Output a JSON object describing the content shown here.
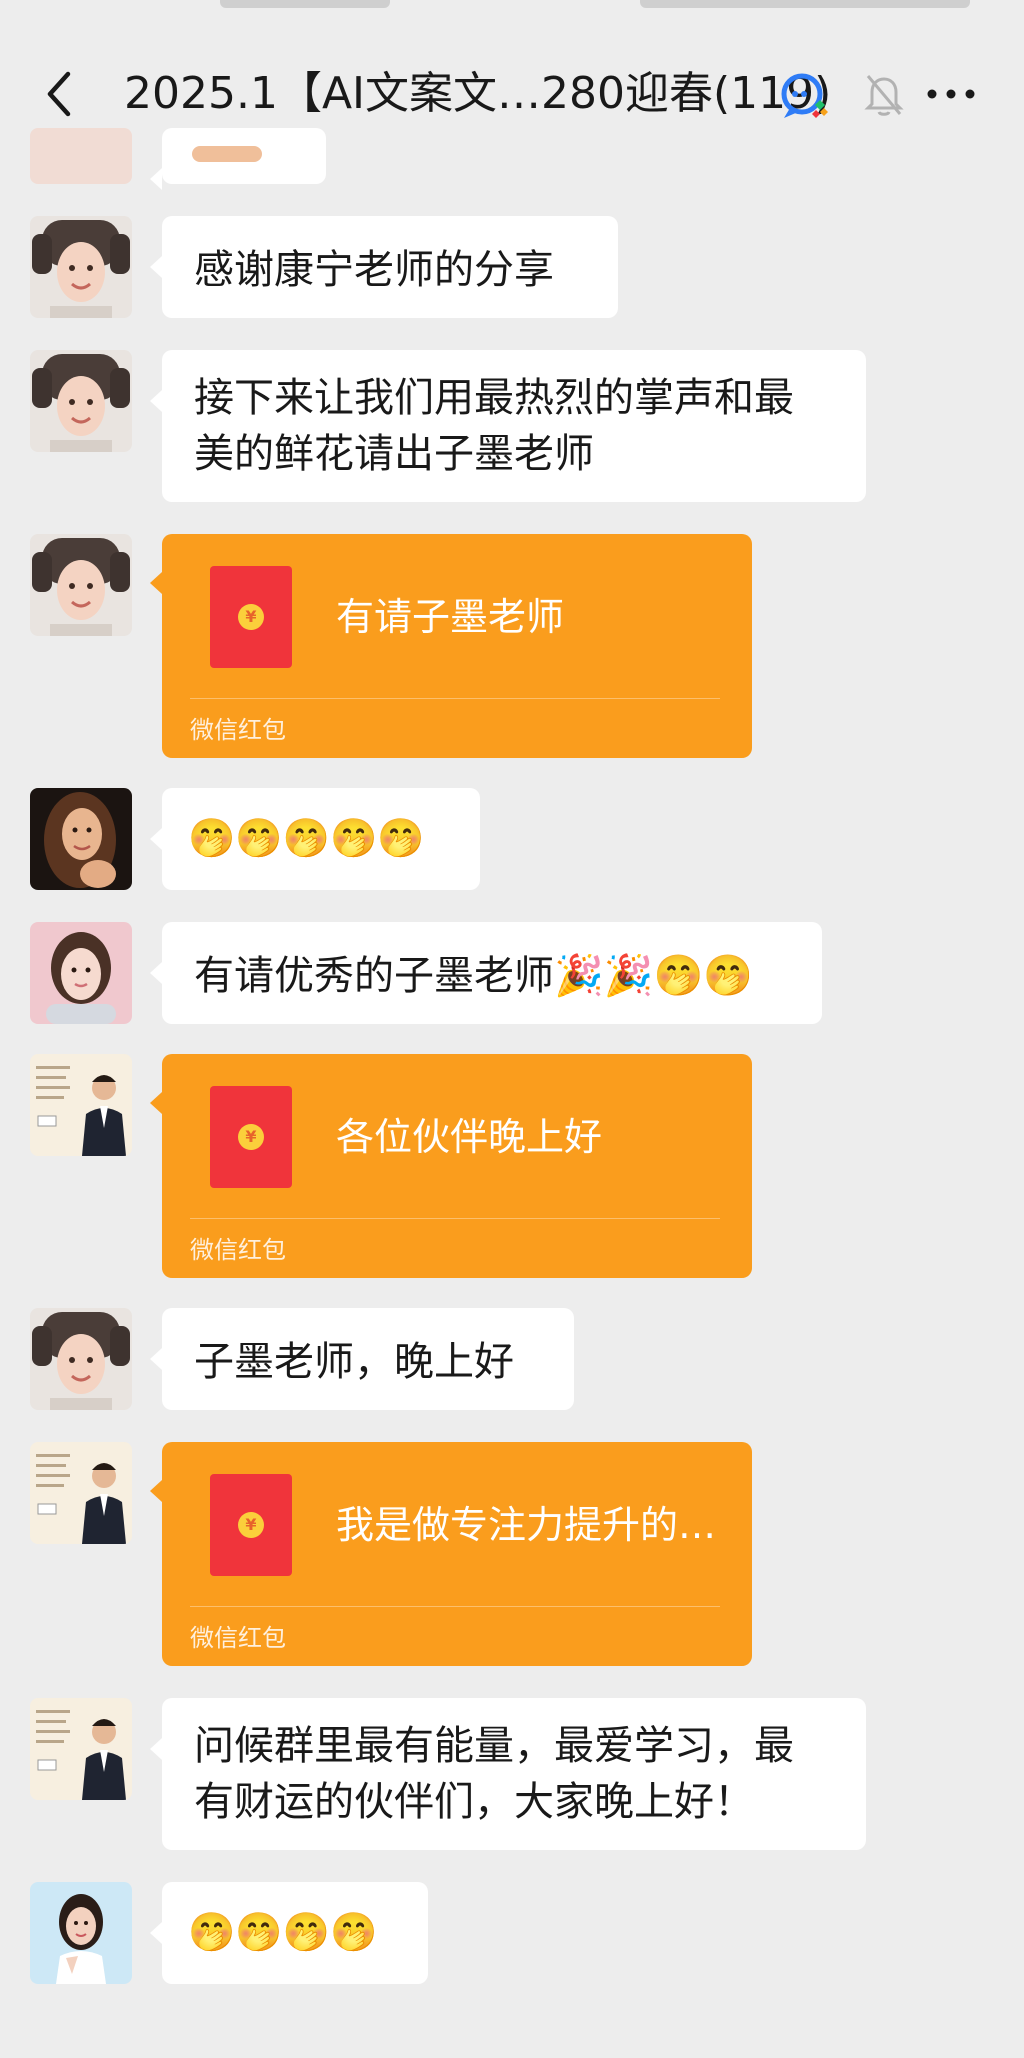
{
  "header": {
    "title": "2025.1【AI文案文…280迎春(119)",
    "back_icon": "chevron-left-icon",
    "ai_icon": "chat-ai-icon",
    "mute_icon": "bell-muted-icon",
    "more_icon": "more-dots-icon"
  },
  "colors": {
    "background": "#ededed",
    "bubble": "#ffffff",
    "red_packet": "#fa9d1d",
    "envelope": "#f0343b"
  },
  "messages": [
    {
      "type": "partial",
      "avatar": "avatar-woman-curlers"
    },
    {
      "type": "text",
      "avatar": "avatar-woman-curlers",
      "text": "感谢康宁老师的分享"
    },
    {
      "type": "text",
      "avatar": "avatar-woman-curlers",
      "lines": [
        "接下来让我们用最热烈的掌声和最",
        "美的鲜花请出子墨老师"
      ]
    },
    {
      "type": "red_packet",
      "avatar": "avatar-woman-curlers",
      "title": "有请子墨老师",
      "label": "微信红包"
    },
    {
      "type": "emoji",
      "avatar": "avatar-woman-long-hair",
      "text": "🤭🤭🤭🤭🤭"
    },
    {
      "type": "text",
      "avatar": "avatar-woman-pink",
      "text": "有请优秀的子墨老师🎉🎉🤭🤭"
    },
    {
      "type": "red_packet",
      "avatar": "avatar-man-suit",
      "title": "各位伙伴晚上好",
      "label": "微信红包"
    },
    {
      "type": "text",
      "avatar": "avatar-woman-curlers",
      "text": "子墨老师，晚上好"
    },
    {
      "type": "red_packet",
      "avatar": "avatar-man-suit",
      "title": "我是做专注力提升的…",
      "label": "微信红包"
    },
    {
      "type": "text",
      "avatar": "avatar-man-suit",
      "lines": [
        "问候群里最有能量，最爱学习，最",
        "有财运的伙伴们，大家晚上好！"
      ]
    },
    {
      "type": "emoji",
      "avatar": "avatar-woman-blue",
      "text": "🤭🤭🤭🤭"
    }
  ]
}
